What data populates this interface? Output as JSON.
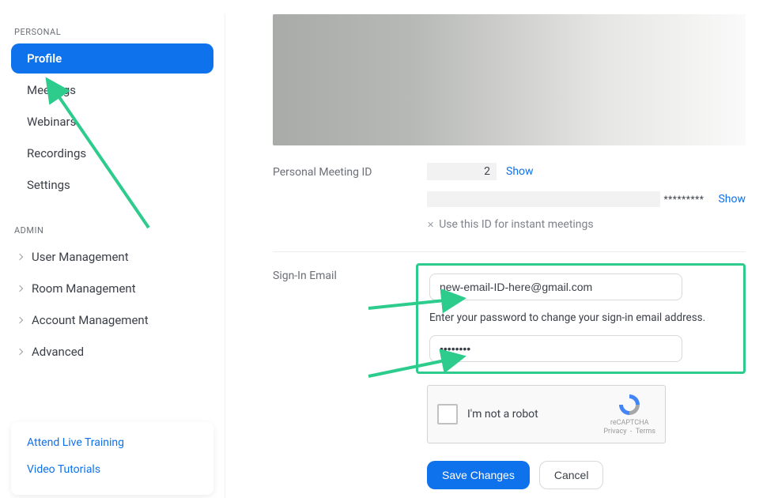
{
  "sidebar": {
    "section_personal": "PERSONAL",
    "profile": "Profile",
    "meetings": "Meetings",
    "webinars": "Webinars",
    "recordings": "Recordings",
    "settings": "Settings",
    "section_admin": "ADMIN",
    "user_mgmt": "User Management",
    "room_mgmt": "Room Management",
    "account_mgmt": "Account Management",
    "advanced": "Advanced",
    "attend_training": "Attend Live Training",
    "video_tutorials": "Video Tutorials"
  },
  "profile": {
    "pmi_label": "Personal Meeting ID",
    "pmi_visible_digit": "2",
    "show": "Show",
    "stars": "*********",
    "instant_text": "Use this ID for instant meetings",
    "signin_label": "Sign-In Email",
    "email_value": "new-email-ID-here@gmail.com",
    "password_helper": "Enter your password to change your sign-in email address.",
    "password_value": "••••••••",
    "recaptcha_label": "I'm not a robot",
    "recaptcha_brand": "reCAPTCHA",
    "recaptcha_privacy": "Privacy",
    "recaptcha_terms": "Terms",
    "save": "Save Changes",
    "cancel": "Cancel"
  }
}
